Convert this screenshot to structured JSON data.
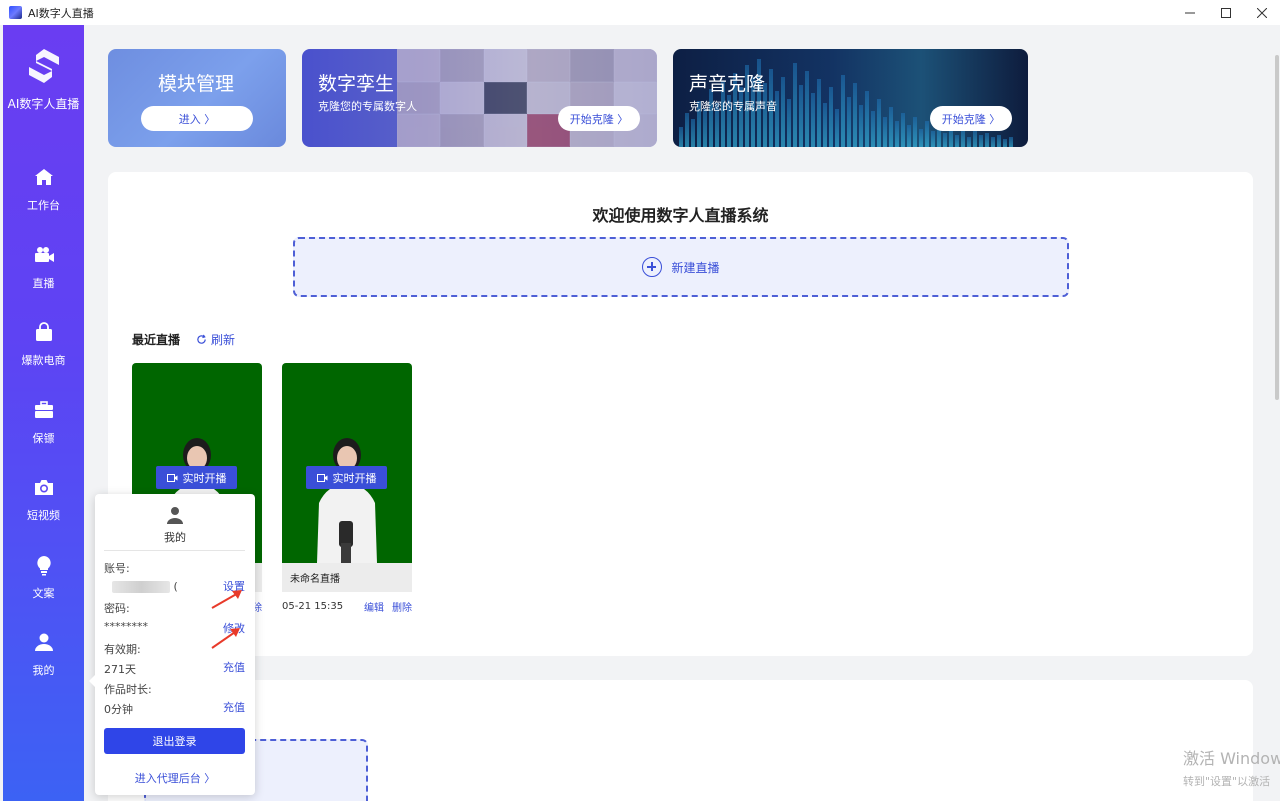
{
  "window": {
    "title": "AI数字人直播",
    "controls": {
      "minimize": "—",
      "maximize": "☐",
      "close": "✕"
    }
  },
  "sidebar": {
    "logo_text": "AI数字人直播",
    "items": [
      {
        "label": "工作台",
        "icon": "home-icon"
      },
      {
        "label": "直播",
        "icon": "video-camera-icon"
      },
      {
        "label": "爆款电商",
        "icon": "shopping-bag-icon"
      },
      {
        "label": "保镖",
        "icon": "briefcase-icon"
      },
      {
        "label": "短视频",
        "icon": "camera-icon"
      },
      {
        "label": "文案",
        "icon": "lightbulb-icon"
      },
      {
        "label": "我的",
        "icon": "user-icon"
      }
    ]
  },
  "banners": [
    {
      "title": "模块管理",
      "subtitle": "",
      "button": "进入 〉"
    },
    {
      "title": "数字孪生",
      "subtitle": "克隆您的专属数字人",
      "button": "开始克隆 〉"
    },
    {
      "title": "声音克隆",
      "subtitle": "克隆您的专属声音",
      "button": "开始克隆 〉"
    }
  ],
  "welcome": {
    "title": "欢迎使用数字人直播系统",
    "new_live": "新建直播"
  },
  "recent": {
    "title": "最近直播",
    "refresh": "刷新",
    "cards": [
      {
        "name": "",
        "date": "",
        "start_button": "实时开播",
        "edit": "编辑",
        "delete": "除"
      },
      {
        "name": "未命名直播",
        "date": "05-21 15:35",
        "start_button": "实时开播",
        "edit": "编辑",
        "delete": "删除"
      }
    ]
  },
  "popover": {
    "user_label": "我的",
    "account_label": "账号:",
    "account_value": "(",
    "account_action": "设置",
    "password_label": "密码:",
    "password_value": "********",
    "password_action": "修改",
    "validity_label": "有效期:",
    "validity_value": "271天",
    "validity_action": "充值",
    "duration_label": "作品时长:",
    "duration_value": "0分钟",
    "duration_action": "充值",
    "logout": "退出登录",
    "agent_link": "进入代理后台 〉"
  },
  "watermark": {
    "line1": "激活 Window",
    "line2": "转到\"设置\"以激活"
  },
  "colors": {
    "accent": "#3a4fd8",
    "sidebar_top": "#6a3df2",
    "sidebar_bottom": "#3c62f4",
    "green_screen": "#006600",
    "arrow": "#e83a2a"
  }
}
